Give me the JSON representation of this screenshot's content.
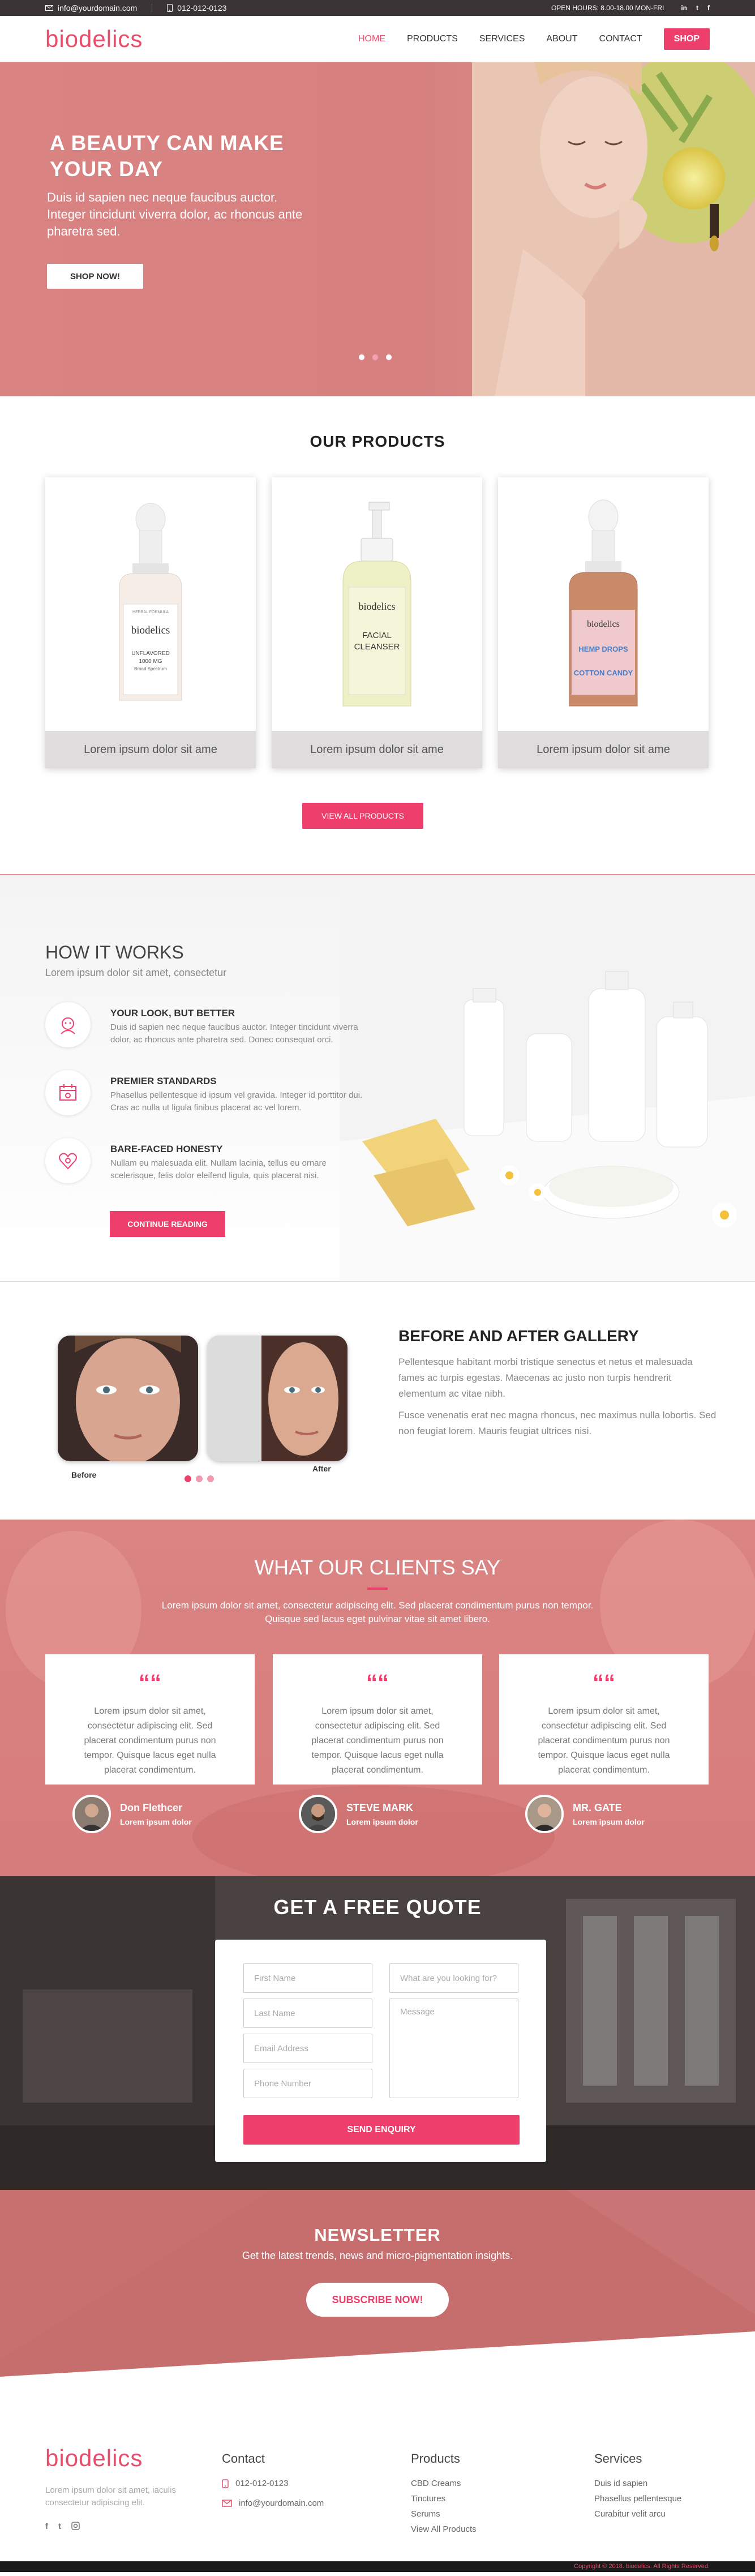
{
  "topbar": {
    "email": "info@yourdomain.com",
    "phone": "012-012-0123",
    "hours": "OPEN HOURS: 8.00-18.00 MON-FRI",
    "social": [
      "in",
      "t",
      "f"
    ]
  },
  "brand": {
    "logo": "biodelics",
    "accent": "#ee3e6b"
  },
  "nav": {
    "items": [
      "HOME",
      "PRODUCTS",
      "SERVICES",
      "ABOUT",
      "CONTACT"
    ],
    "shop": "SHOP"
  },
  "hero": {
    "title_line1": "A BEAUTY CAN MAKE",
    "title_line2": "YOUR DAY",
    "text": "Duis id sapien nec neque faucibus auctor. Integer tincidunt viverra dolor, ac rhoncus ante pharetra sed.",
    "button": "SHOP NOW!"
  },
  "products": {
    "title": "OUR PRODUCTS",
    "items": [
      {
        "caption": "Lorem ipsum dolor sit ame",
        "label_small": "HERBAL FORMULA",
        "brand": "biodelics",
        "label": "UNFLAVORED",
        "label2": "1000 MG",
        "label3": "Broad Spectrum"
      },
      {
        "caption": "Lorem ipsum dolor sit ame",
        "brand": "biodelics",
        "label": "FACIAL",
        "label2": "CLEANSER"
      },
      {
        "caption": "Lorem ipsum dolor sit ame",
        "brand": "biodelics",
        "label": "HEMP DROPS",
        "label2": "COTTON CANDY"
      }
    ],
    "button": "VIEW ALL PRODUCTS"
  },
  "how": {
    "title": "HOW IT WORKS",
    "subtitle": "Lorem ipsum dolor sit amet, consectetur",
    "steps": [
      {
        "title": "YOUR LOOK, BUT BETTER",
        "text": "Duis id sapien nec neque faucibus auctor. Integer tincidunt viverra dolor, ac rhoncus ante pharetra sed. Donec consequat orci."
      },
      {
        "title": "PREMIER STANDARDS",
        "text": "Phasellus pellentesque id ipsum vel gravida. Integer id porttitor dui. Cras ac nulla ut ligula finibus placerat ac vel lorem."
      },
      {
        "title": "BARE-FACED HONESTY",
        "text": "Nullam eu malesuada elit. Nullam lacinia, tellus eu ornare scelerisque, felis dolor eleifend ligula, quis placerat nisi."
      }
    ],
    "button": "CONTINUE READING"
  },
  "gallery": {
    "title": "BEFORE AND AFTER GALLERY",
    "p1": "Pellentesque habitant morbi tristique senectus et netus et malesuada fames ac turpis egestas. Maecenas ac justo non turpis hendrerit elementum ac vitae nibh.",
    "p2": "Fusce venenatis erat nec magna rhoncus, nec maximus nulla lobortis. Sed non feugiat lorem. Mauris feugiat ultrices nisi.",
    "before": "Before",
    "after": "After"
  },
  "testimonials": {
    "title": "WHAT OUR CLIENTS SAY",
    "subtitle_line1": "Lorem ipsum dolor sit amet, consectetur adipiscing elit. Sed placerat condimentum purus non tempor.",
    "subtitle_line2": "Quisque sed lacus eget  pulvinar vitae sit amet libero.",
    "items": [
      {
        "quote": "Lorem ipsum dolor sit amet, consectetur adipiscing elit. Sed placerat condimentum purus non tempor. Quisque lacus eget nulla placerat condimentum.",
        "name": "Don Flethcer",
        "role": "Lorem ipsum dolor"
      },
      {
        "quote": "Lorem ipsum dolor sit amet, consectetur adipiscing elit. Sed placerat condimentum purus non tempor. Quisque lacus eget nulla placerat condimentum.",
        "name": "STEVE MARK",
        "role": "Lorem ipsum dolor"
      },
      {
        "quote": "Lorem ipsum dolor sit amet, consectetur adipiscing elit. Sed placerat condimentum purus non tempor. Quisque lacus eget nulla placerat condimentum.",
        "name": "MR. GATE",
        "role": "Lorem ipsum dolor"
      }
    ]
  },
  "quote": {
    "title": "GET A FREE QUOTE",
    "first_name": "First Name",
    "last_name": "Last Name",
    "email": "Email Address",
    "phone": "Phone Number",
    "looking": "What are you looking for?",
    "message": "Message",
    "button": "SEND ENQUIRY"
  },
  "newsletter": {
    "title": "NEWSLETTER",
    "text": "Get the latest trends, news and micro-pigmentation insights.",
    "button": "SUBSCRIBE NOW!"
  },
  "footer": {
    "about": "Lorem ipsum dolor sit amet, iaculis consectetur adipiscing elit.",
    "contact_title": "Contact",
    "phone": "012-012-0123",
    "email": "info@yourdomain.com",
    "products_title": "Products",
    "products": [
      "CBD Creams",
      "Tinctures",
      "Serums",
      "View All Products"
    ],
    "services_title": "Services",
    "services": [
      "Duis id sapien",
      "Phasellus pellentesque",
      "Curabitur velit arcu"
    ],
    "copyright": "Copyright © 2018. biodelics. All Rights Reserved."
  }
}
